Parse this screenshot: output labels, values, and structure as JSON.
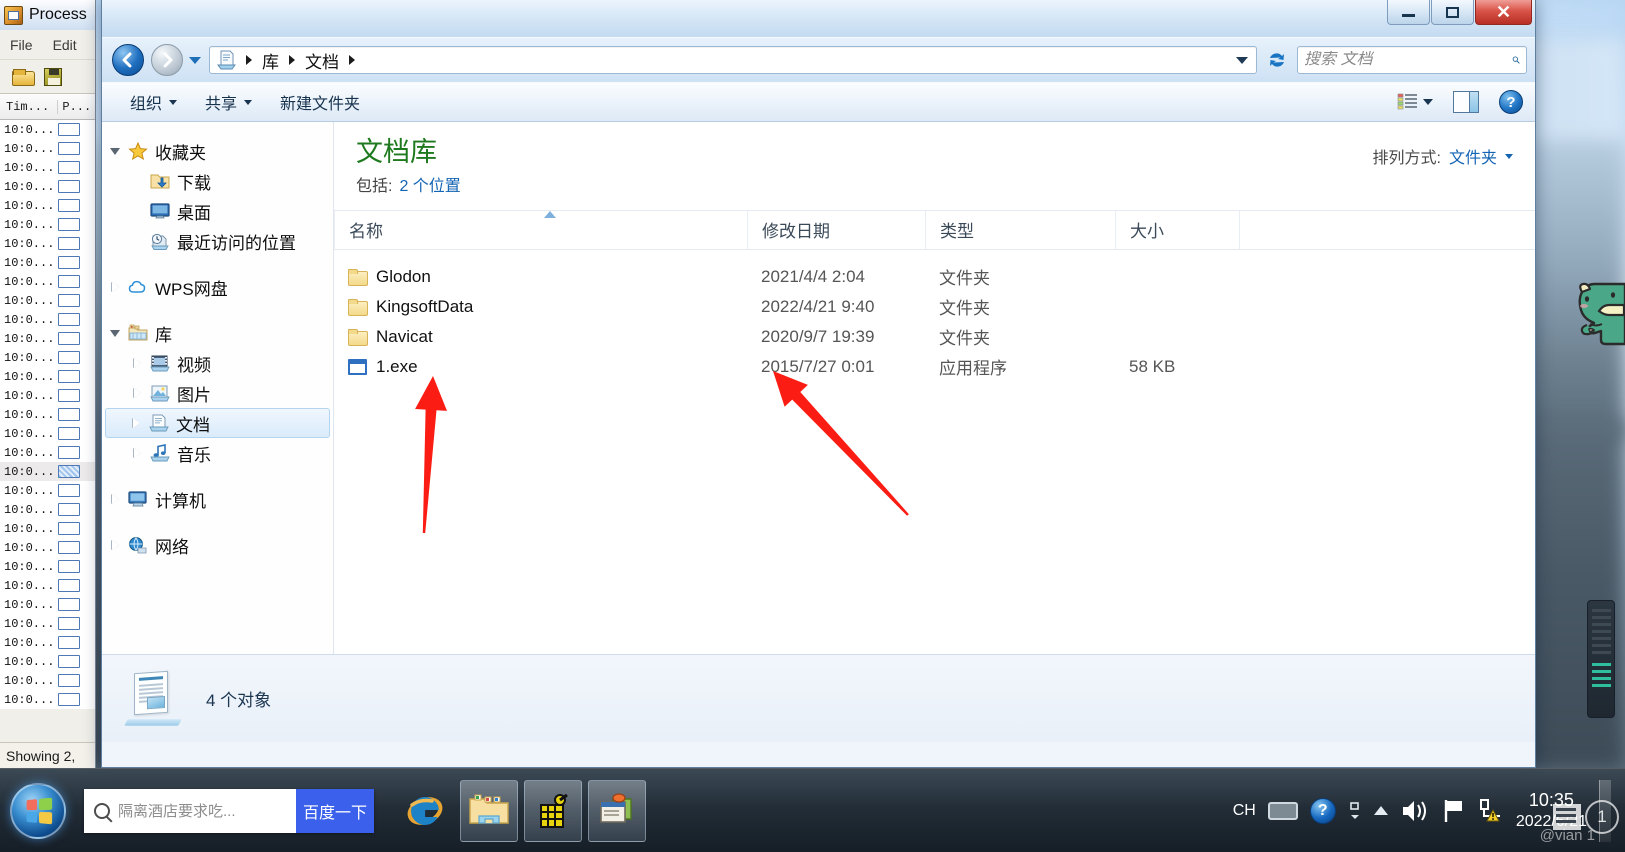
{
  "procmon": {
    "title": "Process",
    "menu": [
      "File",
      "Edit"
    ],
    "columns": [
      "Tim...",
      "P..."
    ],
    "row_time": "10:0...",
    "row_count": 31,
    "selected_row_index": 18,
    "status": "Showing 2,"
  },
  "explorer": {
    "window_controls": {
      "minimize": "—",
      "maximize": "□",
      "close": "✕"
    },
    "address": {
      "crumbs": [
        "库",
        "文档"
      ],
      "icon": "library-documents-icon"
    },
    "search": {
      "placeholder": "搜索 文档",
      "value": "",
      "icon": "search-icon"
    },
    "toolbar": {
      "organize": "组织",
      "share": "共享",
      "new_folder": "新建文件夹",
      "view_icon": "list-view-icon",
      "preview_pane_icon": "preview-pane-icon",
      "help_icon": "help-icon"
    },
    "sidebar": [
      {
        "label": "收藏夹",
        "icon": "star-icon",
        "twisty": "open",
        "indent": 0,
        "selected": false
      },
      {
        "label": "下载",
        "icon": "downloads-icon",
        "twisty": "none",
        "indent": 1,
        "selected": false
      },
      {
        "label": "桌面",
        "icon": "desktop-icon",
        "twisty": "none",
        "indent": 1,
        "selected": false
      },
      {
        "label": "最近访问的位置",
        "icon": "recent-places-icon",
        "twisty": "none",
        "indent": 1,
        "selected": false
      },
      {
        "gap": true
      },
      {
        "label": "WPS网盘",
        "icon": "cloud-icon",
        "twisty": "closed",
        "indent": 0,
        "selected": false
      },
      {
        "gap": true
      },
      {
        "label": "库",
        "icon": "library-icon",
        "twisty": "open",
        "indent": 0,
        "selected": false
      },
      {
        "label": "视频",
        "icon": "video-icon",
        "twisty": "closed",
        "indent": 1,
        "selected": false
      },
      {
        "label": "图片",
        "icon": "pictures-icon",
        "twisty": "closed",
        "indent": 1,
        "selected": false
      },
      {
        "label": "文档",
        "icon": "documents-icon",
        "twisty": "closed",
        "indent": 1,
        "selected": true
      },
      {
        "label": "音乐",
        "icon": "music-icon",
        "twisty": "closed",
        "indent": 1,
        "selected": false
      },
      {
        "gap": true
      },
      {
        "label": "计算机",
        "icon": "computer-icon",
        "twisty": "closed",
        "indent": 0,
        "selected": false
      },
      {
        "gap": true
      },
      {
        "label": "网络",
        "icon": "network-icon",
        "twisty": "closed",
        "indent": 0,
        "selected": false
      }
    ],
    "library": {
      "title": "文档库",
      "includes_label": "包括:",
      "includes_value": "2 个位置",
      "arrange_label": "排列方式:",
      "arrange_value": "文件夹"
    },
    "columns": {
      "name": "名称",
      "date": "修改日期",
      "type": "类型",
      "size": "大小",
      "sorted_by": "name",
      "sort_direction": "asc"
    },
    "files": [
      {
        "name": "Glodon",
        "date": "2021/4/4 2:04",
        "type": "文件夹",
        "size": "",
        "icon": "folder-icon"
      },
      {
        "name": "KingsoftData",
        "date": "2022/4/21 9:40",
        "type": "文件夹",
        "size": "",
        "icon": "folder-icon"
      },
      {
        "name": "Navicat",
        "date": "2020/9/7 19:39",
        "type": "文件夹",
        "size": "",
        "icon": "folder-icon"
      },
      {
        "name": "1.exe",
        "date": "2015/7/27 0:01",
        "type": "应用程序",
        "size": "58 KB",
        "icon": "exe-icon"
      }
    ],
    "status": {
      "text": "4 个对象",
      "icon": "documents-library-icon"
    }
  },
  "annotations": {
    "arrow_color": "#fb1d14",
    "arrows": [
      {
        "name": "arrow-to-filename",
        "points": "from (424,530) to (432,378)"
      },
      {
        "name": "arrow-to-date",
        "points": "from (908,512) to (778,372)"
      }
    ]
  },
  "mascot": {
    "name": "dinosaur-mascot",
    "color": "#4aa888"
  },
  "taskbar": {
    "start_icon": "windows-start-orb",
    "baidu": {
      "placeholder": "隔离酒店要求吃...",
      "button": "百度一下",
      "search_icon": "search-icon",
      "button_color": "#3b60ec"
    },
    "apps": [
      {
        "name": "internet-explorer-icon",
        "framed": false
      },
      {
        "name": "windows-explorer-icon",
        "framed": true
      },
      {
        "name": "grenade-app-icon",
        "framed": true
      },
      {
        "name": "process-monitor-icon",
        "framed": true
      }
    ],
    "tray": {
      "ime": "CH",
      "keyboard_icon": "keyboard-icon",
      "help_icon": "help-icon",
      "expand_icon": "show-hidden-icons-icon",
      "volume_icon": "volume-icon",
      "flag_icon": "action-center-flag-icon",
      "network_icon": "network-warning-icon",
      "time": "10:35",
      "date": "2022/6/21"
    },
    "watermark": "@vian 1"
  }
}
